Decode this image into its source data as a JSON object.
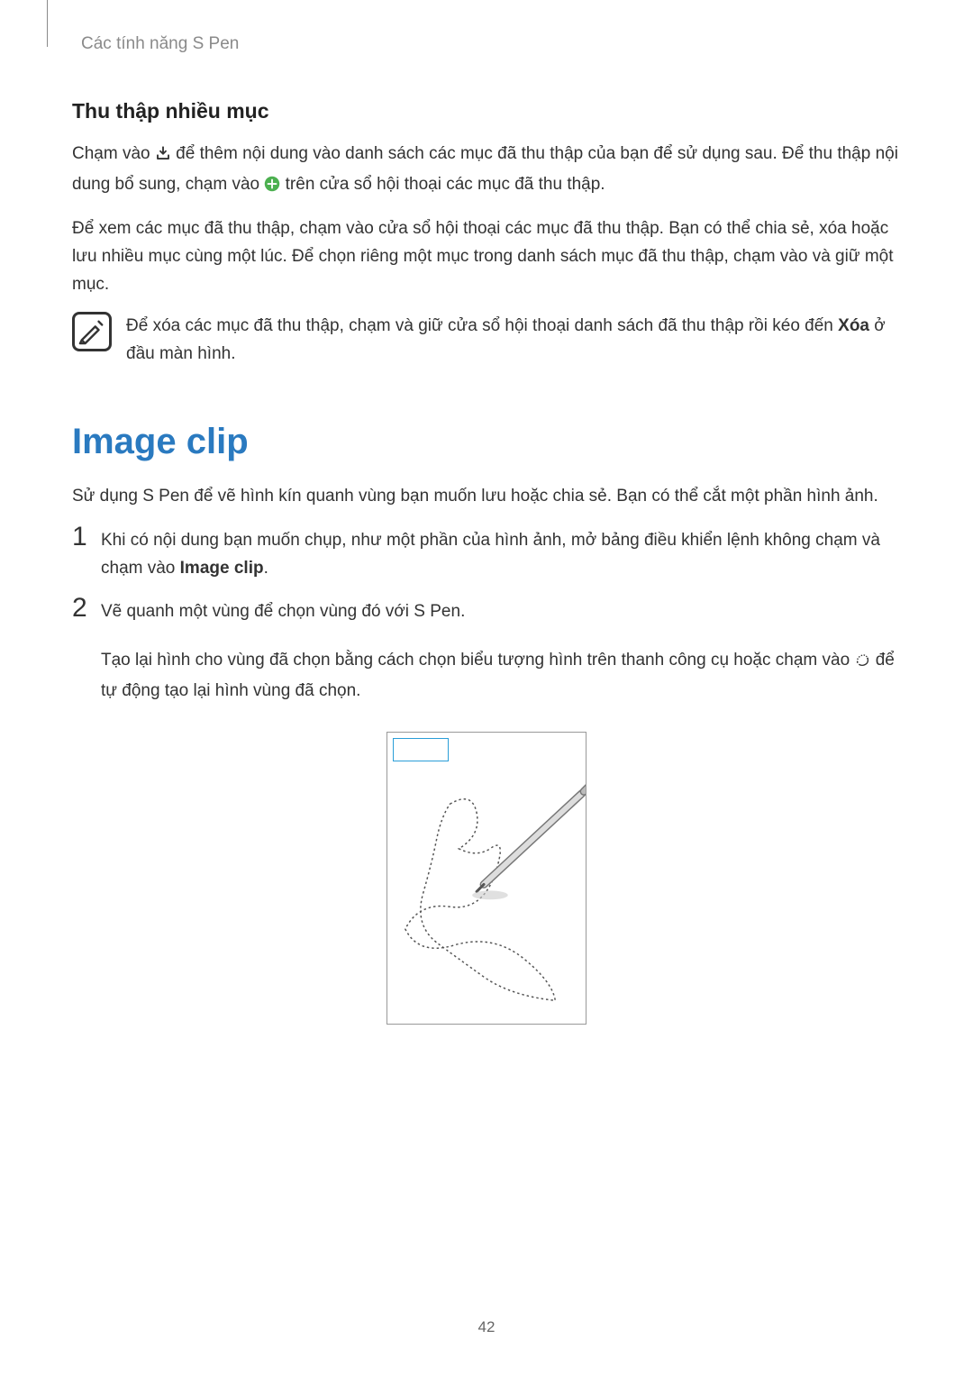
{
  "header": {
    "breadcrumb": "Các tính năng S Pen"
  },
  "section1": {
    "title": "Thu thập nhiều mục",
    "p1a": "Chạm vào ",
    "p1b": " để thêm nội dung vào danh sách các mục đã thu thập của bạn để sử dụng sau. Để thu thập nội dung bổ sung, chạm vào ",
    "p1c": " trên cửa sổ hội thoại các mục đã thu thập.",
    "p2": "Để xem các mục đã thu thập, chạm vào cửa sổ hội thoại các mục đã thu thập. Bạn có thể chia sẻ, xóa hoặc lưu nhiều mục cùng một lúc. Để chọn riêng một mục trong danh sách mục đã thu thập, chạm vào và giữ một mục."
  },
  "note": {
    "text_a": "Để xóa các mục đã thu thập, chạm và giữ cửa sổ hội thoại danh sách đã thu thập rồi kéo đến ",
    "bold": "Xóa",
    "text_b": " ở đầu màn hình."
  },
  "main": {
    "heading": "Image clip",
    "intro": "Sử dụng S Pen để vẽ hình kín quanh vùng bạn muốn lưu hoặc chia sẻ. Bạn có thể cắt một phần hình ảnh.",
    "steps": [
      {
        "num": "1",
        "text_a": "Khi có nội dung bạn muốn chụp, như một phần của hình ảnh, mở bảng điều khiển lệnh không chạm và chạm vào ",
        "bold": "Image clip",
        "text_b": "."
      },
      {
        "num": "2",
        "text_a": "Vẽ quanh một vùng để chọn vùng đó với S Pen.",
        "sub_a": "Tạo lại hình cho vùng đã chọn bằng cách chọn biểu tượng hình trên thanh công cụ hoặc chạm vào ",
        "sub_b": " để tự động tạo lại hình vùng đã chọn."
      }
    ]
  },
  "page_number": "42"
}
